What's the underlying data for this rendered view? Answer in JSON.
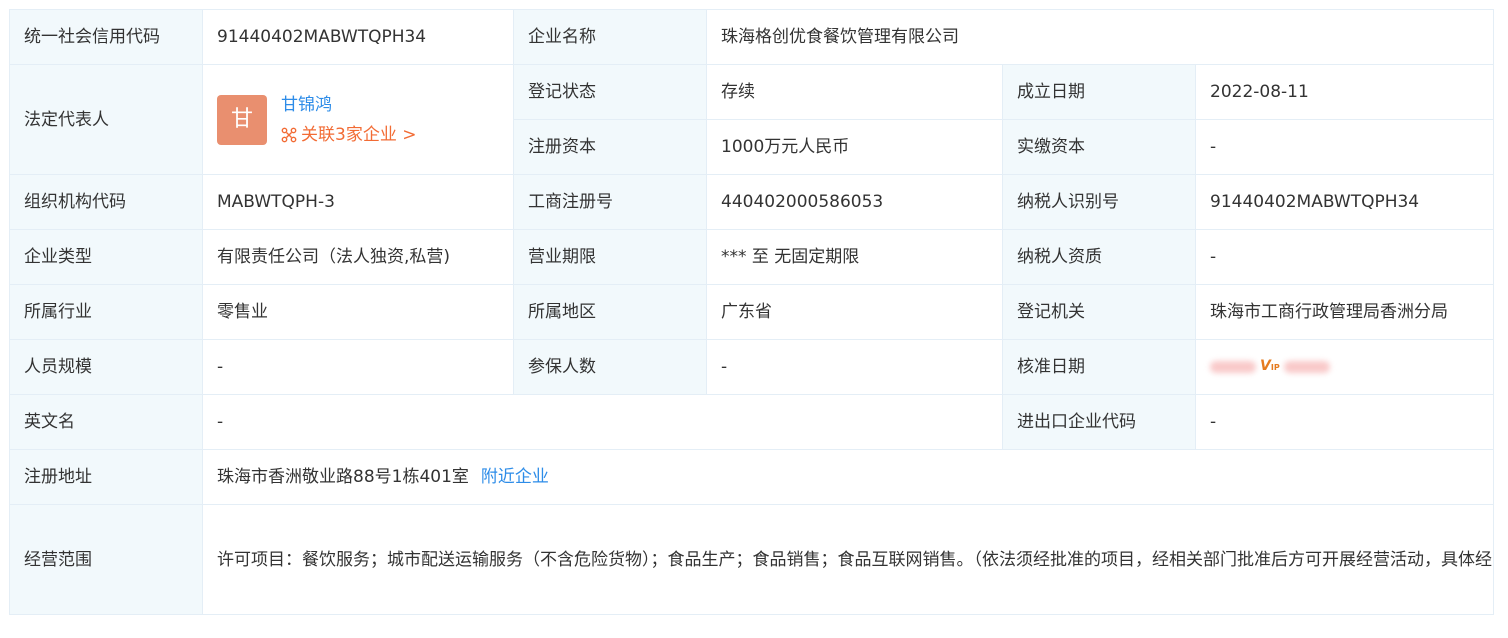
{
  "rows": {
    "credit_code_label": "统一社会信用代码",
    "credit_code_value": "91440402MABWTQPH34",
    "company_name_label": "企业名称",
    "company_name_value": "珠海格创优食餐饮管理有限公司",
    "legal_rep_label": "法定代表人",
    "legal_rep": {
      "avatar_char": "甘",
      "name": "甘锦鸿",
      "related_text": "关联3家企业 >"
    },
    "reg_status_label": "登记状态",
    "reg_status_value": "存续",
    "est_date_label": "成立日期",
    "est_date_value": "2022-08-11",
    "reg_capital_label": "注册资本",
    "reg_capital_value": "1000万元人民币",
    "paid_capital_label": "实缴资本",
    "paid_capital_value": "-",
    "org_code_label": "组织机构代码",
    "org_code_value": "MABWTQPH-3",
    "biz_reg_no_label": "工商注册号",
    "biz_reg_no_value": "440402000586053",
    "taxpayer_id_label": "纳税人识别号",
    "taxpayer_id_value": "91440402MABWTQPH34",
    "company_type_label": "企业类型",
    "company_type_value": "有限责任公司（法人独资,私营)",
    "biz_term_label": "营业期限",
    "biz_term_value": "*** 至 无固定期限",
    "taxpayer_qual_label": "纳税人资质",
    "taxpayer_qual_value": "-",
    "industry_label": "所属行业",
    "industry_value": "零售业",
    "region_label": "所属地区",
    "region_value": "广东省",
    "reg_authority_label": "登记机关",
    "reg_authority_value": "珠海市工商行政管理局香洲分局",
    "staff_size_label": "人员规模",
    "staff_size_value": "-",
    "insured_count_label": "参保人数",
    "insured_count_value": "-",
    "approval_date_label": "核准日期",
    "approval_date_vip": "V",
    "approval_date_vip_sub": "IP",
    "english_name_label": "英文名",
    "english_name_value": "-",
    "import_export_label": "进出口企业代码",
    "import_export_value": "-",
    "reg_address_label": "注册地址",
    "reg_address_value": "珠海市香洲敬业路88号1栋401室",
    "nearby_link": "附近企业",
    "biz_scope_label": "经营范围",
    "biz_scope_value": "许可项目：餐饮服务；城市配送运输服务（不含危险货物）；食品生产；食品销售；食品互联网销售。（依法须经批准的项目，经相关部门批准后方可开展经营活动，具体经营项目以相关部门批准，文件或许可证件为准）一般项目：外卖递送服务；餐饮管理；食品进出口；专业保洁、清洗、消毒服务；日用品销售；礼品花卉销售；农副产品销售；初级农产品收购。（除依法须经批准的项目外，凭营业执照依法自主开展经营活动)"
  },
  "colors": {
    "label_bg": "#f2f9fc",
    "border": "#e4eef6",
    "link": "#2d8ce8",
    "accent_orange": "#f26b34",
    "avatar_bg": "#e98f6f"
  }
}
